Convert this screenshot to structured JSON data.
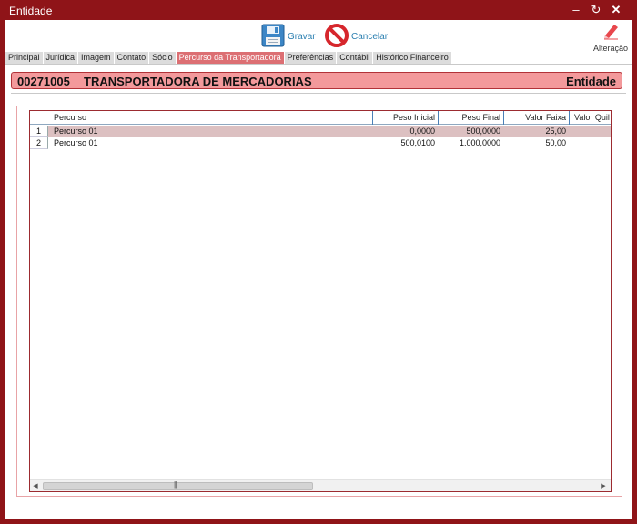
{
  "window": {
    "title": "Entidade",
    "controls": {
      "minimize": "–",
      "restore": "↻",
      "close": "✕"
    }
  },
  "toolbar": {
    "save_label": "Gravar",
    "cancel_label": "Cancelar",
    "mode_label": "Alteração"
  },
  "tabs": [
    {
      "label": "Principal",
      "active": false
    },
    {
      "label": "Jurídica",
      "active": false
    },
    {
      "label": "Imagem",
      "active": false
    },
    {
      "label": "Contato",
      "active": false
    },
    {
      "label": "Sócio",
      "active": false
    },
    {
      "label": "Percurso da Transportadora",
      "active": true
    },
    {
      "label": "Preferências",
      "active": false
    },
    {
      "label": "Contábil",
      "active": false
    },
    {
      "label": "Histórico Financeiro",
      "active": false
    }
  ],
  "entity": {
    "code": "00271005",
    "name": "TRANSPORTADORA DE MERCADORIAS",
    "kind": "Entidade"
  },
  "grid": {
    "columns": [
      "Percurso",
      "Peso Inicial",
      "Peso Final",
      "Valor Faixa",
      "Valor Quil"
    ],
    "rows": [
      {
        "num": "1",
        "percurso": "Percurso 01",
        "peso_inicial": "0,0000",
        "peso_final": "500,0000",
        "valor_faixa": "25,00",
        "valor_quil": "",
        "selected": true
      },
      {
        "num": "2",
        "percurso": "Percurso 01",
        "peso_inicial": "500,0100",
        "peso_final": "1.000,0000",
        "valor_faixa": "50,00",
        "valor_quil": "",
        "selected": false
      }
    ],
    "scroll": {
      "left_arrow": "◀",
      "right_arrow": "▶",
      "grip": "|||"
    }
  },
  "colors": {
    "window_frame": "#8f1418",
    "active_tab": "#dc6f73",
    "entity_header_bg": "#f3999b",
    "selected_row": "#dcc0c1",
    "link_blue": "#2b7fb0"
  }
}
